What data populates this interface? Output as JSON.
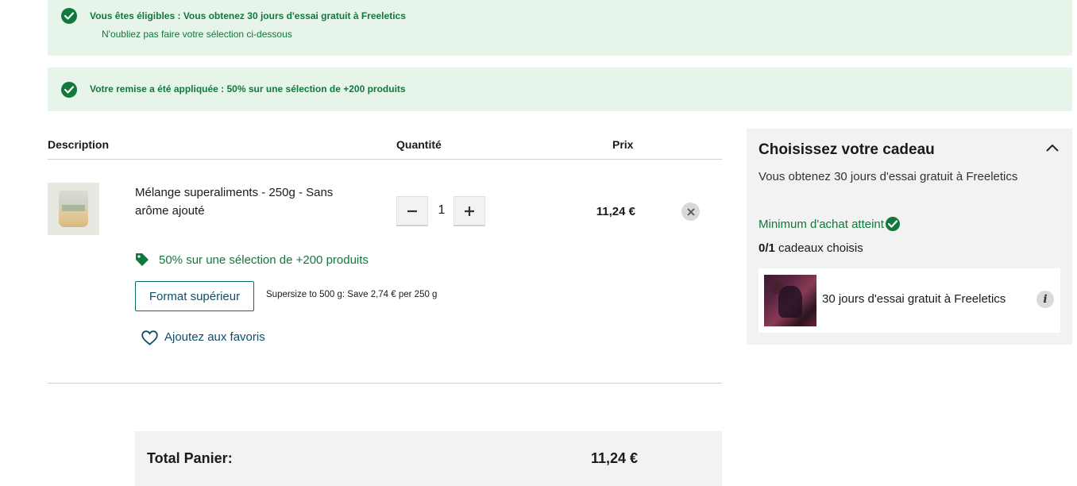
{
  "banners": {
    "eligibility": {
      "title": "Vous êtes éligibles : Vous obtenez 30 jours d'essai gratuit à Freeletics",
      "subtitle": "N'oubliez pas faire votre sélection ci-dessous"
    },
    "discount": {
      "title": "Votre remise a été appliquée : 50% sur une sélection de +200 produits"
    }
  },
  "cart": {
    "headers": {
      "description": "Description",
      "quantity": "Quantité",
      "price": "Prix"
    },
    "item": {
      "name": "Mélange superaliments - 250g - Sans arôme ajouté",
      "quantity": "1",
      "price": "11,24 €",
      "promo": "50% sur une sélection de +200 produits",
      "upgrade_button": "Format supérieur",
      "upgrade_note": "Supersize to 500 g: Save 2,74 € per 250 g",
      "favorite_link": "Ajoutez aux favoris"
    },
    "total": {
      "label": "Total Panier:",
      "value": "11,24 €"
    }
  },
  "gift_panel": {
    "title": "Choisissez votre cadeau",
    "subtitle": "Vous obtenez 30 jours d'essai gratuit à Freeletics",
    "minimum": "Minimum d'achat atteint",
    "count": "0/1",
    "count_suffix": " cadeaux choisis",
    "gift_item": "30 jours d'essai gratuit à Freeletics",
    "info_glyph": "i"
  },
  "colors": {
    "success_green": "#12783c",
    "banner_bg": "#e6f4ea",
    "link_teal": "#0d4f6b"
  },
  "icons": [
    "check-circle-icon",
    "tag-icon",
    "heart-icon",
    "close-icon",
    "chevron-up-icon",
    "info-icon",
    "minus-icon",
    "plus-icon"
  ]
}
